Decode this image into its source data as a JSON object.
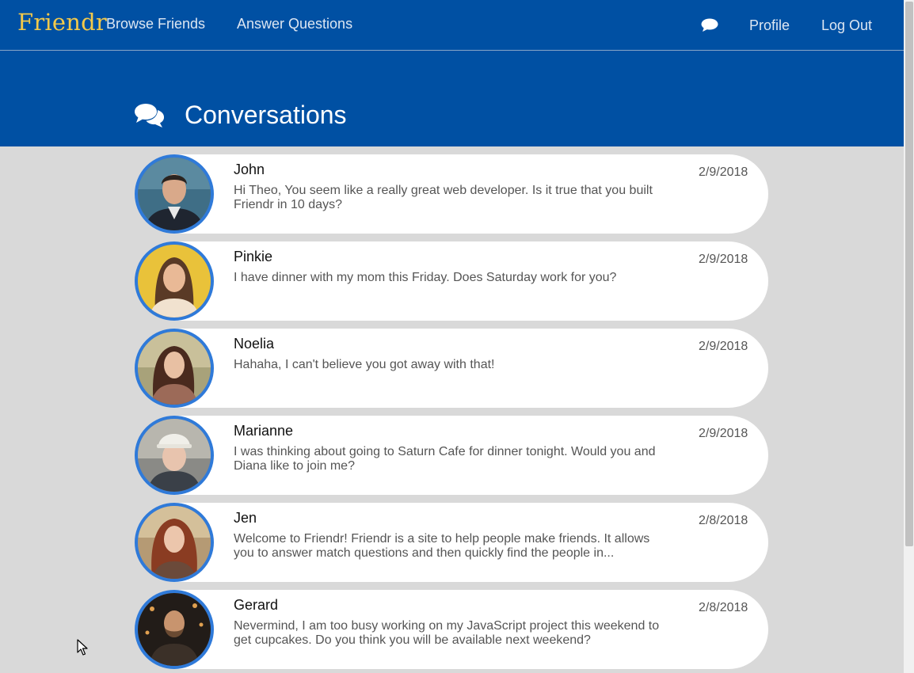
{
  "nav": {
    "brand": "Friendr",
    "links": [
      "Browse Friends",
      "Answer Questions"
    ],
    "chat_icon": "comment-icon",
    "profile": "Profile",
    "logout": "Log Out"
  },
  "header": {
    "icon": "comments-icon",
    "title": "Conversations"
  },
  "colors": {
    "primary": "#0050a3",
    "brand": "#f3c94a",
    "avatar_ring": "#2f7ad9",
    "background": "#d9d9d9",
    "card": "#ffffff"
  },
  "conversations": [
    {
      "name": "John",
      "message": "Hi Theo, You seem like a really great web developer. Is it true that you built Friendr in 10 days?",
      "date": "2/9/2018"
    },
    {
      "name": "Pinkie",
      "message": "I have dinner with my mom this Friday. Does Saturday work for you?",
      "date": "2/9/2018"
    },
    {
      "name": "Noelia",
      "message": "Hahaha, I can't believe you got away with that!",
      "date": "2/9/2018"
    },
    {
      "name": "Marianne",
      "message": "I was thinking about going to Saturn Cafe for dinner tonight. Would you and Diana like to join me?",
      "date": "2/9/2018"
    },
    {
      "name": "Jen",
      "message": "Welcome to Friendr! Friendr is a site to help people make friends. It allows you to answer match questions and then quickly find the people in...",
      "date": "2/8/2018"
    },
    {
      "name": "Gerard",
      "message": "Nevermind, I am too busy working on my JavaScript project this weekend to get cupcakes. Do you think you will be available next weekend?",
      "date": "2/8/2018"
    }
  ]
}
